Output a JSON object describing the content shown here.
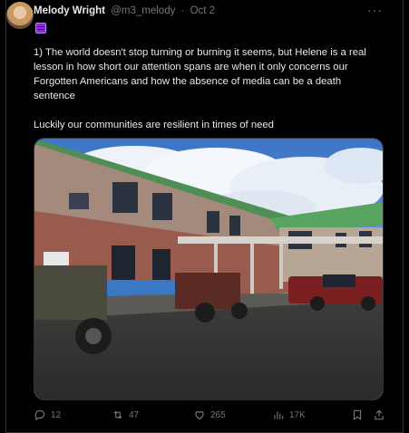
{
  "tweet": {
    "author_name": "Melody Wright",
    "handle": "@m3_melody",
    "separator": "·",
    "date": "Oct 2",
    "badge_icon": "abacus-emoji-icon",
    "paragraphs": [
      "1) The world doesn't stop turning or burning it seems, but Helene is a real lesson in how short our attention spans are when it only concerns our Forgotten Americans and how the absence of media can be a death sentence",
      "Luckily our communities are resilient in times of need"
    ],
    "media": {
      "icon": "photo-school-building"
    },
    "stats": {
      "replies": "12",
      "reposts": "47",
      "likes": "265",
      "views": "17K"
    }
  },
  "colors": {
    "background": "#000000",
    "text": "#e7e9ea",
    "muted": "#71767b",
    "border": "#2f3336"
  }
}
